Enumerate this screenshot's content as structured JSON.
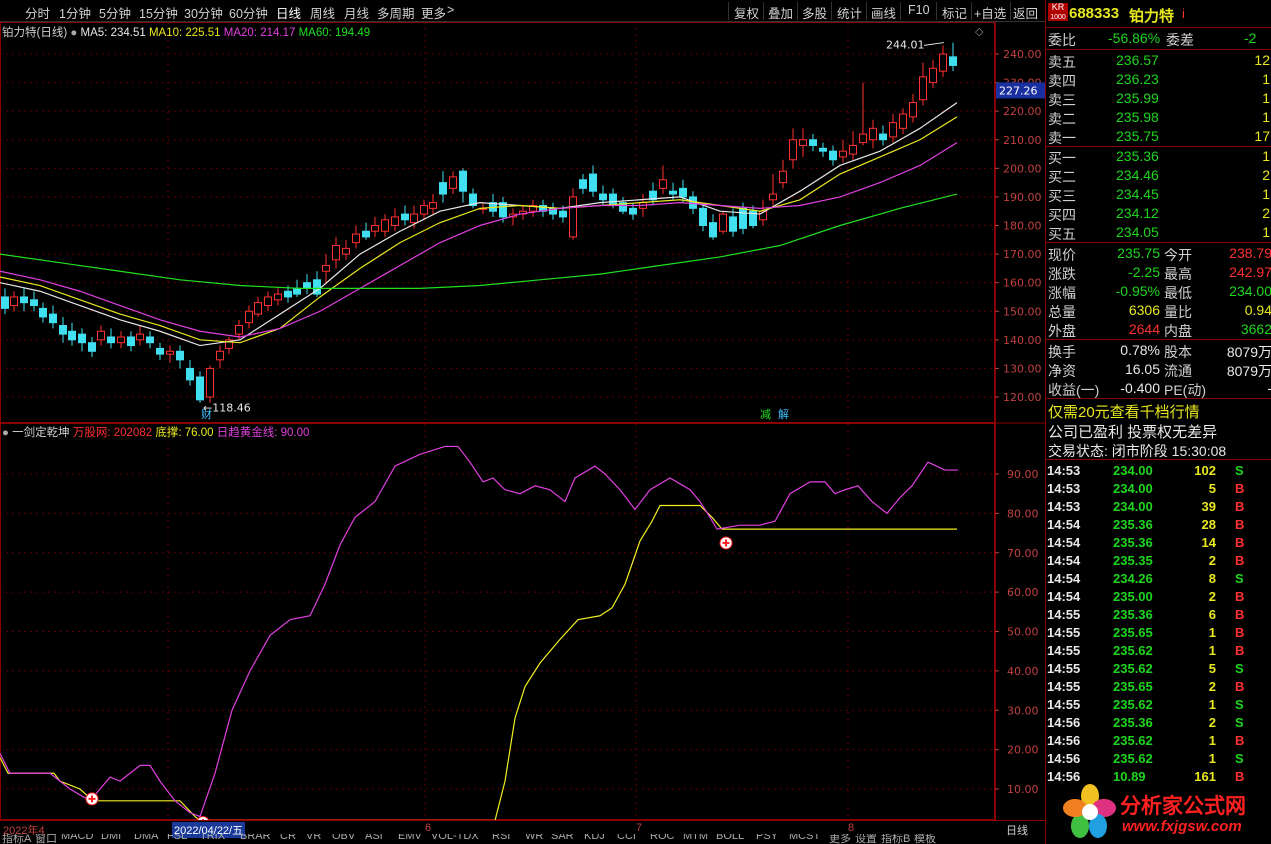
{
  "toolbar": {
    "periods": [
      "分时",
      "1分钟",
      "5分钟",
      "15分钟",
      "30分钟",
      "60分钟",
      "日线",
      "周线",
      "月线",
      "多周期",
      "更多"
    ],
    "active_period": "日线",
    "right_buttons": [
      "复权",
      "叠加",
      "多股",
      "统计",
      "画线",
      "F10",
      "标记",
      "+自选",
      "返回"
    ]
  },
  "main_chart": {
    "stock_label": "铂力特(日线)",
    "ma_labels": [
      {
        "text": "MA5: 234.51",
        "color": "#e8e8e8"
      },
      {
        "text": "MA10: 225.51",
        "color": "#e8e820"
      },
      {
        "text": "MA20: 214.17",
        "color": "#e040e0"
      },
      {
        "text": "MA60: 194.49",
        "color": "#20e020"
      }
    ],
    "high_label": "244.01",
    "low_label": "118.46",
    "tag_cai": "财",
    "tag_jian": "减",
    "tag_jie": "解",
    "current_price_tag": "227.26",
    "y_ticks": [
      "240.00",
      "230.00",
      "220.00",
      "210.00",
      "200.00",
      "190.00",
      "180.00",
      "170.00",
      "160.00",
      "150.00",
      "140.00",
      "130.00",
      "120.00"
    ]
  },
  "indicator": {
    "name": "一剑定乾坤",
    "sub1": "万股网: 202082",
    "sub2": "底撑: 76.00",
    "sub3": "日趋黄金线: 90.00",
    "y_ticks": [
      "90.00",
      "80.00",
      "70.00",
      "60.00",
      "50.00",
      "40.00",
      "30.00",
      "20.00",
      "10.00"
    ]
  },
  "date_axis": {
    "labels": [
      "2022年4",
      "2022/04/22/五",
      "6",
      "7",
      "8"
    ],
    "period_label": "日线"
  },
  "bottom_tabs": [
    "指标A",
    "窗口",
    "MACD",
    "DMI",
    "DMA",
    "FSL",
    "TRIX",
    "BRAR",
    "CR",
    "VR",
    "OBV",
    "ASI",
    "EMV",
    "VOL-TDX",
    "RSI",
    "WR",
    "SAR",
    "KDJ",
    "CCI",
    "ROC",
    "MTM",
    "BOLL",
    "PSY",
    "MCST",
    "更多",
    "设置",
    "指标B",
    "模板"
  ],
  "quote": {
    "code": "688333",
    "name": "铂力特",
    "badge": "KR",
    "badge_sub": "1000",
    "flag": "i",
    "weibi_label": "委比",
    "weibi": "-56.86%",
    "weicha_label": "委差",
    "weicha": "-2",
    "asks": [
      {
        "label": "卖五",
        "price": "236.57",
        "vol": "12"
      },
      {
        "label": "卖四",
        "price": "236.23",
        "vol": "1"
      },
      {
        "label": "卖三",
        "price": "235.99",
        "vol": "1"
      },
      {
        "label": "卖二",
        "price": "235.98",
        "vol": "1"
      },
      {
        "label": "卖一",
        "price": "235.75",
        "vol": "17"
      }
    ],
    "bids": [
      {
        "label": "买一",
        "price": "235.36",
        "vol": "1"
      },
      {
        "label": "买二",
        "price": "234.46",
        "vol": "2"
      },
      {
        "label": "买三",
        "price": "234.45",
        "vol": "1"
      },
      {
        "label": "买四",
        "price": "234.12",
        "vol": "2"
      },
      {
        "label": "买五",
        "price": "234.05",
        "vol": "1"
      }
    ],
    "stats": [
      {
        "l1": "现价",
        "v1": "235.75",
        "c1": "green",
        "l2": "今开",
        "v2": "238.79",
        "c2": "red"
      },
      {
        "l1": "涨跌",
        "v1": "-2.25",
        "c1": "green",
        "l2": "最高",
        "v2": "242.97",
        "c2": "red"
      },
      {
        "l1": "涨幅",
        "v1": "-0.95%",
        "c1": "green",
        "l2": "最低",
        "v2": "234.00",
        "c2": "green"
      },
      {
        "l1": "总量",
        "v1": "6306",
        "c1": "yellow",
        "l2": "量比",
        "v2": "0.94",
        "c2": "yellow"
      },
      {
        "l1": "外盘",
        "v1": "2644",
        "c1": "red",
        "l2": "内盘",
        "v2": "3662",
        "c2": "green"
      }
    ],
    "stats2": [
      {
        "l1": "换手",
        "v1": "0.78%",
        "l2": "股本",
        "v2": "8079万"
      },
      {
        "l1": "净资",
        "v1": "16.05",
        "l2": "流通",
        "v2": "8079万"
      },
      {
        "l1": "收益(一)",
        "v1": "-0.400",
        "l2": "PE(动)",
        "v2": "-"
      }
    ],
    "promo": "仅需20元查看千档行情",
    "notice": "公司已盈利 投票权无差异",
    "status": "交易状态: 闭市阶段 15:30:08",
    "ticks": [
      {
        "t": "14:53",
        "p": "234.00",
        "v": "102",
        "d": "S"
      },
      {
        "t": "14:53",
        "p": "234.00",
        "v": "5",
        "d": "B"
      },
      {
        "t": "14:53",
        "p": "234.00",
        "v": "39",
        "d": "B"
      },
      {
        "t": "14:54",
        "p": "235.36",
        "v": "28",
        "d": "B"
      },
      {
        "t": "14:54",
        "p": "235.36",
        "v": "14",
        "d": "B"
      },
      {
        "t": "14:54",
        "p": "235.35",
        "v": "2",
        "d": "B"
      },
      {
        "t": "14:54",
        "p": "234.26",
        "v": "8",
        "d": "S"
      },
      {
        "t": "14:54",
        "p": "235.00",
        "v": "2",
        "d": "B"
      },
      {
        "t": "14:55",
        "p": "235.36",
        "v": "6",
        "d": "B"
      },
      {
        "t": "14:55",
        "p": "235.65",
        "v": "1",
        "d": "B"
      },
      {
        "t": "14:55",
        "p": "235.62",
        "v": "1",
        "d": "B"
      },
      {
        "t": "14:55",
        "p": "235.62",
        "v": "5",
        "d": "S"
      },
      {
        "t": "14:55",
        "p": "235.65",
        "v": "2",
        "d": "B"
      },
      {
        "t": "14:55",
        "p": "235.62",
        "v": "1",
        "d": "S"
      },
      {
        "t": "14:56",
        "p": "235.36",
        "v": "2",
        "d": "S"
      },
      {
        "t": "14:56",
        "p": "235.62",
        "v": "1",
        "d": "B"
      },
      {
        "t": "14:56",
        "p": "235.62",
        "v": "1",
        "d": "S"
      },
      {
        "t": "14:56",
        "p": "10.89",
        "v": "161",
        "d": "B"
      }
    ]
  },
  "watermark": {
    "name": "分析家公式网",
    "url": "www.fxjgsw.com"
  }
}
